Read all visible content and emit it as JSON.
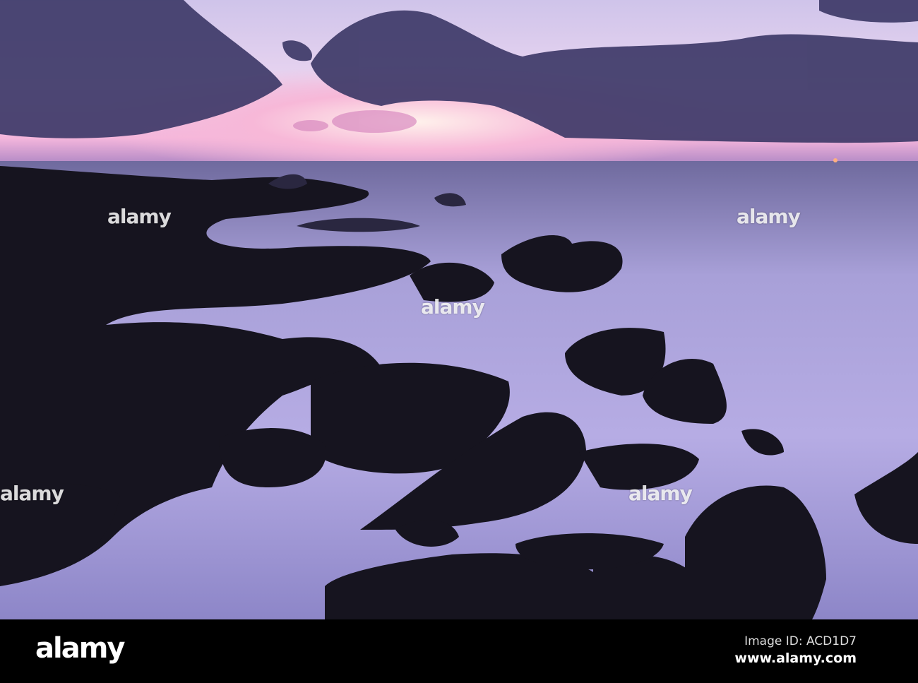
{
  "photo": {
    "subject": "rocky shoreline at sunset",
    "colors": {
      "sky_glow": "#f7c8e4",
      "cloud": "#3c3866",
      "sea": "#a9a2dc",
      "rock": "#15131f"
    }
  },
  "watermarks": [
    "alamy",
    "alamy",
    "alamy",
    "alamy",
    "alamy"
  ],
  "footer": {
    "logo": "alamy",
    "image_id": "Image ID: ACD1D7",
    "website": "www.alamy.com"
  }
}
